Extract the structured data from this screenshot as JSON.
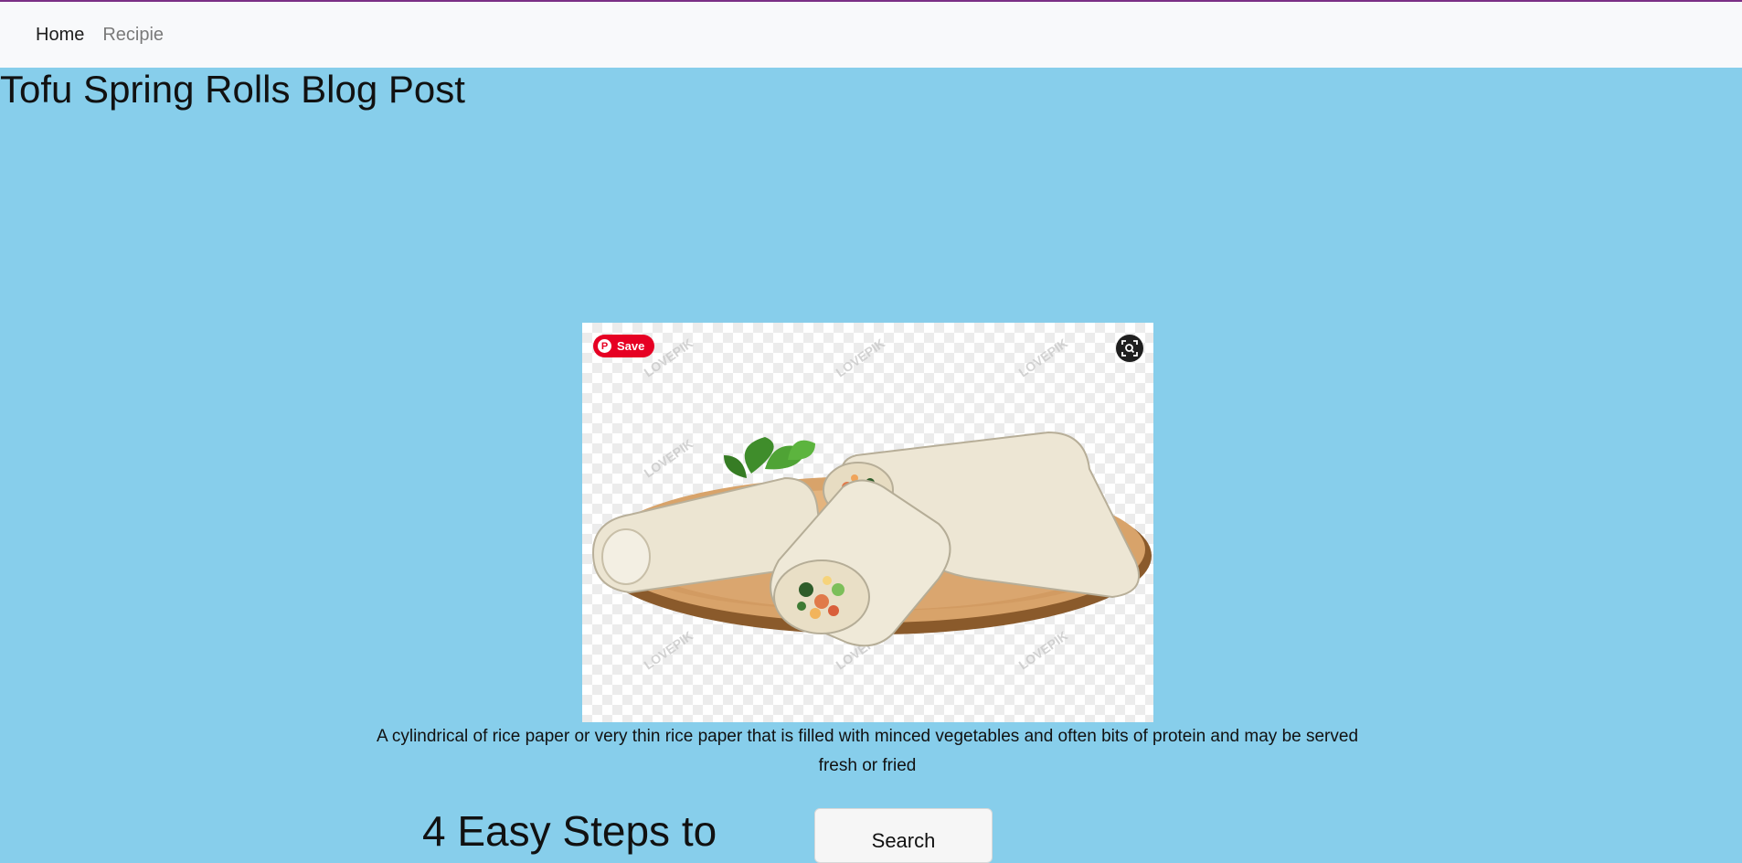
{
  "nav": {
    "home_label": "Home",
    "recipe_label": "Recipie"
  },
  "page_title": "Tofu Spring Rolls Blog Post",
  "image": {
    "pin_save_label": "Save",
    "pin_logo": "P",
    "watermark": "LOVEPIK"
  },
  "caption": "A cylindrical of rice paper or very thin rice paper that is filled with minced vegetables and often bits of protein and may be served fresh or fried",
  "steps_heading": "4 Easy Steps to",
  "search_button_label": "Search",
  "colors": {
    "page_background": "#87ceeb",
    "navbar_background": "#f8f9fb",
    "top_accent": "#7b2f86",
    "pinterest_red": "#e60023"
  },
  "icons": {
    "pin": "pinterest-icon",
    "lens": "visual-search-icon"
  }
}
